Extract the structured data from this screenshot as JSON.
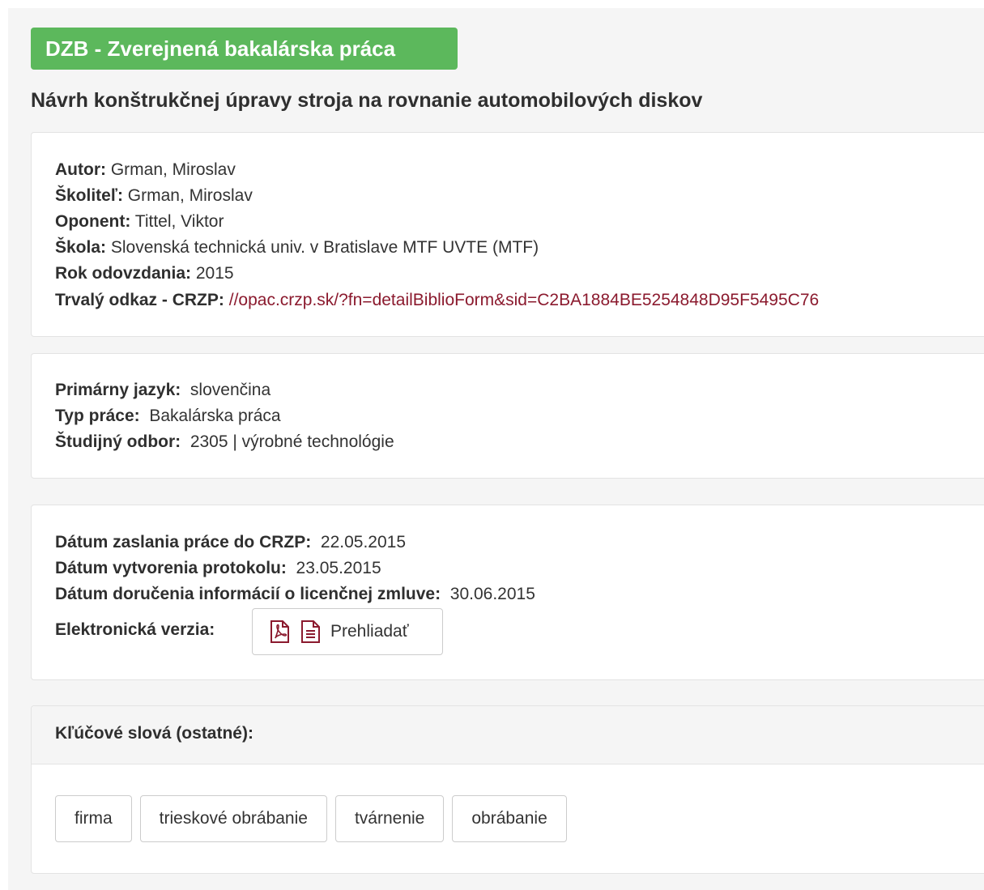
{
  "badge": {
    "label": "DZB - Zverejnená bakalárska práca",
    "color": "#5cb85c"
  },
  "title": "Návrh konštrukčnej úpravy stroja na rovnanie automobilových diskov",
  "info": {
    "author_label": "Autor:",
    "author": "Grman, Miroslav",
    "supervisor_label": "Školiteľ:",
    "supervisor": "Grman, Miroslav",
    "opponent_label": "Oponent:",
    "opponent": "Tittel, Viktor",
    "school_label": "Škola:",
    "school": "Slovenská technická univ. v Bratislave MTF UVTE (MTF)",
    "year_label": "Rok odovzdania:",
    "year": "2015",
    "permalink_label": "Trvalý odkaz - CRZP:",
    "permalink": "//opac.crzp.sk/?fn=detailBiblioForm&sid=C2BA1884BE5254848D95F5495C76"
  },
  "details": {
    "language_label": "Primárny jazyk:",
    "language": "slovenčina",
    "type_label": "Typ práce:",
    "type": "Bakalárska práca",
    "field_label": "Študijný odbor:",
    "field": "2305 | výrobné technológie"
  },
  "dates": {
    "sent_label": "Dátum zaslania práce do CRZP:",
    "sent": "22.05.2015",
    "protocol_label": "Dátum vytvorenia protokolu:",
    "protocol": "23.05.2015",
    "license_label": "Dátum doručenia informácií o licenčnej zmluve:",
    "license": "30.06.2015",
    "electronic_label": "Elektronická verzia:",
    "view_button": "Prehliadať",
    "icons": [
      "pdf-icon",
      "document-icon"
    ],
    "icon_color": "#8b1a2e"
  },
  "keywords": {
    "header": "Kľúčové slová (ostatné):",
    "items": [
      "firma",
      "trieskové obrábanie",
      "tvárnenie",
      "obrábanie"
    ]
  }
}
